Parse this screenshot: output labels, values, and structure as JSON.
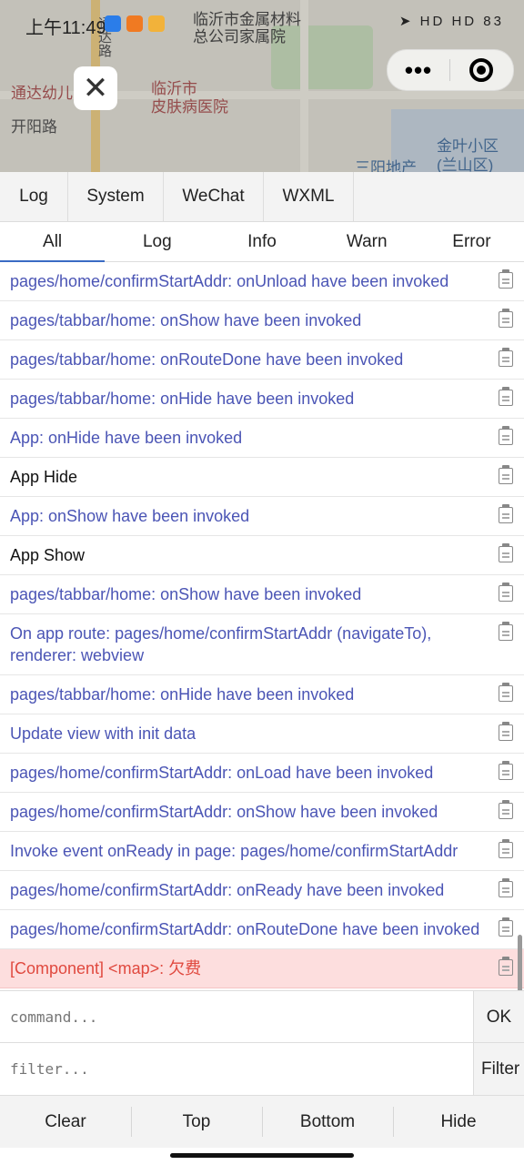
{
  "status_bar": {
    "time": "上午11:49",
    "icons_right": "HD HD 83"
  },
  "map": {
    "labels": {
      "road_north": "通达路",
      "school": "通达幼儿",
      "hospital": "临沂市\n皮肤病医院",
      "company": "临沂市金属材料\n总公司家属院",
      "kaiyang": "开阳路",
      "district": "金叶小区\n(兰山区)",
      "realestate": "三阳地产"
    }
  },
  "overlay": {
    "close_icon": "close-icon",
    "capsule_more": "•••",
    "capsule_target_icon": "target-icon"
  },
  "console": {
    "top_tabs": [
      {
        "label": "Log",
        "active": true
      },
      {
        "label": "System",
        "active": false
      },
      {
        "label": "WeChat",
        "active": false
      },
      {
        "label": "WXML",
        "active": false
      }
    ],
    "sub_tabs": [
      {
        "label": "All",
        "active": true
      },
      {
        "label": "Log",
        "active": false
      },
      {
        "label": "Info",
        "active": false
      },
      {
        "label": "Warn",
        "active": false
      },
      {
        "label": "Error",
        "active": false
      }
    ],
    "logs": [
      {
        "text": "pages/home/confirmStartAddr: onUnload have been invoked",
        "kind": "info"
      },
      {
        "text": "pages/tabbar/home: onShow have been invoked",
        "kind": "info"
      },
      {
        "text": "pages/tabbar/home: onRouteDone have been invoked",
        "kind": "info"
      },
      {
        "text": "pages/tabbar/home: onHide have been invoked",
        "kind": "info"
      },
      {
        "text": "App: onHide have been invoked",
        "kind": "info"
      },
      {
        "text": "App Hide",
        "kind": "plain"
      },
      {
        "text": "App: onShow have been invoked",
        "kind": "info"
      },
      {
        "text": "App Show",
        "kind": "plain"
      },
      {
        "text": "pages/tabbar/home: onShow have been invoked",
        "kind": "info"
      },
      {
        "text": "On app route: pages/home/confirmStartAddr (navigateTo), renderer: webview",
        "kind": "info"
      },
      {
        "text": "pages/tabbar/home: onHide have been invoked",
        "kind": "info"
      },
      {
        "text": "Update view with init data",
        "kind": "info"
      },
      {
        "text": "pages/home/confirmStartAddr: onLoad have been invoked",
        "kind": "info"
      },
      {
        "text": "pages/home/confirmStartAddr: onShow have been invoked",
        "kind": "info"
      },
      {
        "text": "Invoke event onReady in page: pages/home/confirmStartAddr",
        "kind": "info"
      },
      {
        "text": "pages/home/confirmStartAddr: onReady have been invoked",
        "kind": "info"
      },
      {
        "text": "pages/home/confirmStartAddr: onRouteDone have been invoked",
        "kind": "info"
      },
      {
        "text": "[Component] <map>: 欠费",
        "kind": "error"
      }
    ],
    "command": {
      "placeholder": "command...",
      "button": "OK"
    },
    "filter": {
      "placeholder": "filter...",
      "button": "Filter"
    },
    "actions": [
      "Clear",
      "Top",
      "Bottom",
      "Hide"
    ],
    "colors": {
      "info": "#4b55b5",
      "error_bg": "#fddede",
      "error_text": "#e0493f",
      "active_tab": "#3a6bc4"
    }
  }
}
